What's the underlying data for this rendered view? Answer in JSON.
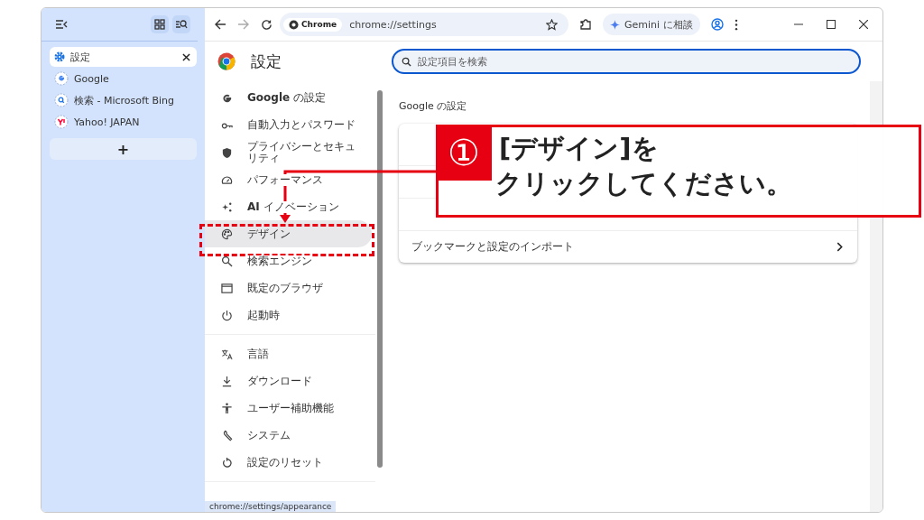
{
  "sidebar": {
    "tabs": [
      {
        "title": "設定",
        "kind": "gear",
        "selected": true
      },
      {
        "title": "Google",
        "kind": "google",
        "selected": false
      },
      {
        "title": "検索 - Microsoft Bing",
        "kind": "search",
        "selected": false
      },
      {
        "title": "Yahoo! JAPAN",
        "kind": "yahoo",
        "selected": false
      }
    ],
    "new_tab": "+"
  },
  "toolbar": {
    "chip": "Chrome",
    "url": "chrome://settings",
    "gemini": "Gemini に相談"
  },
  "header": {
    "title": "設定",
    "search_placeholder": "設定項目を検索"
  },
  "nav": {
    "groups": [
      [
        {
          "label": "**Google** の設定",
          "selected": false
        },
        {
          "label": "自動入力とパスワード",
          "selected": false
        },
        {
          "label": "プライバシーとセキュリティ",
          "selected": false
        },
        {
          "label": "パフォーマンス",
          "selected": false
        },
        {
          "label": "**AI** イノベーション",
          "selected": false
        },
        {
          "label": "デザイン",
          "selected": true
        },
        {
          "label": "検索エンジン",
          "selected": false
        },
        {
          "label": "既定のブラウザ",
          "selected": false
        },
        {
          "label": "起動時",
          "selected": false
        }
      ],
      [
        {
          "label": "言語",
          "selected": false
        },
        {
          "label": "ダウンロード",
          "selected": false
        },
        {
          "label": "ユーザー補助機能",
          "selected": false
        },
        {
          "label": "システム",
          "selected": false
        },
        {
          "label": "設定のリセット",
          "selected": false
        }
      ]
    ]
  },
  "section_title": "Google の設定",
  "card": {
    "rows": [
      {
        "kind": "account"
      },
      {
        "kind": "link"
      },
      {
        "kind": "link"
      },
      {
        "kind": "link",
        "label": "ブックマークと設定のインポート"
      }
    ]
  },
  "callout": {
    "number": "①",
    "lines": [
      "[デザイン]を",
      "クリックしてください。"
    ]
  },
  "status_url": "chrome://settings/appearance"
}
